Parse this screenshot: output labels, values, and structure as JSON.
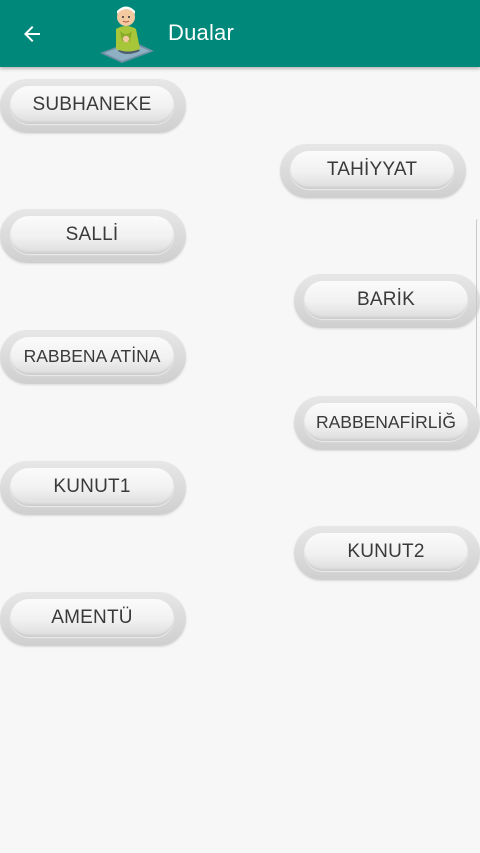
{
  "appbar": {
    "title": "Dualar",
    "bg_color": "#00897b",
    "back_icon": "arrow-left-icon",
    "app_icon": "praying-boy-icon"
  },
  "prayers": [
    {
      "label": "SUBHANEKE"
    },
    {
      "label": "TAHİYYAT"
    },
    {
      "label": "SALLİ"
    },
    {
      "label": "BARİK"
    },
    {
      "label": "RABBENA ATİNA"
    },
    {
      "label": "RABBENAFİRLİĞ"
    },
    {
      "label": "KUNUT1"
    },
    {
      "label": "KUNUT2"
    },
    {
      "label": "AMENTÜ"
    }
  ]
}
